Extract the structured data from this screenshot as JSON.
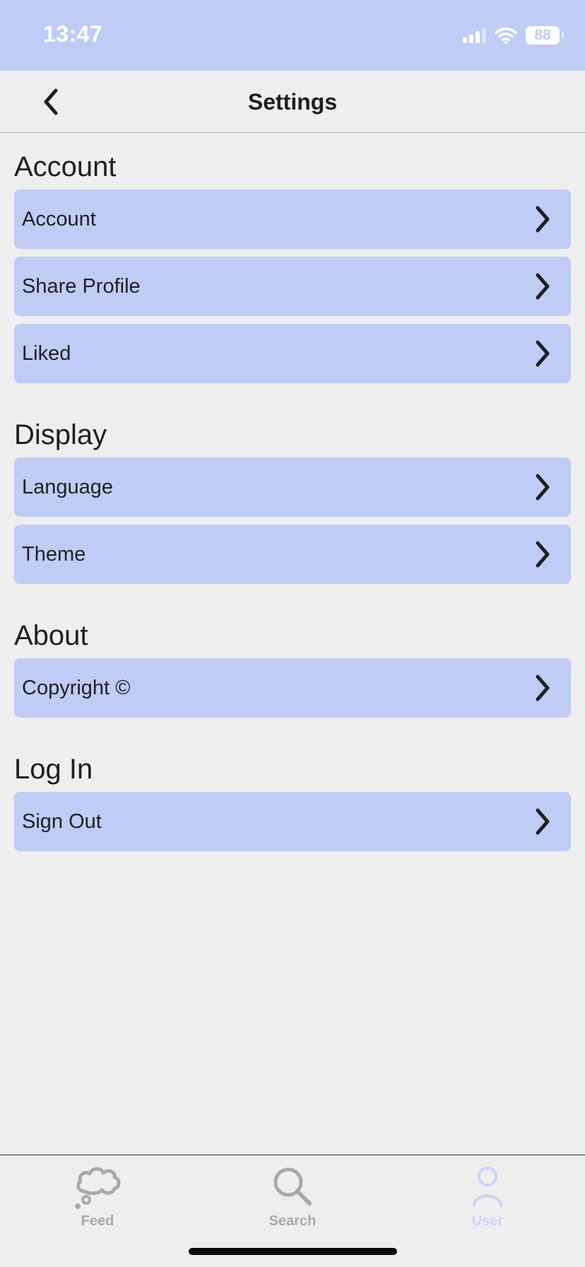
{
  "status_bar": {
    "time": "13:47",
    "battery": "88"
  },
  "nav": {
    "title": "Settings",
    "back_icon": "chevron-left-icon"
  },
  "sections": [
    {
      "title": "Account",
      "items": [
        {
          "label": "Account"
        },
        {
          "label": "Share Profile"
        },
        {
          "label": "Liked"
        }
      ]
    },
    {
      "title": "Display",
      "items": [
        {
          "label": "Language"
        },
        {
          "label": "Theme"
        }
      ]
    },
    {
      "title": "About",
      "items": [
        {
          "label": "Copyright ©"
        }
      ]
    },
    {
      "title": "Log In",
      "items": [
        {
          "label": "Sign Out"
        }
      ]
    }
  ],
  "tabs": [
    {
      "label": "Feed",
      "icon": "cloud-thought-icon",
      "active": false
    },
    {
      "label": "Search",
      "icon": "search-icon",
      "active": false
    },
    {
      "label": "User",
      "icon": "user-icon",
      "active": true
    }
  ],
  "colors": {
    "accent": "#bfccf5",
    "background": "#efeeef",
    "text": "#1f1f21",
    "tab_inactive": "#a9a9ab",
    "tab_active": "#c9d4f8"
  }
}
